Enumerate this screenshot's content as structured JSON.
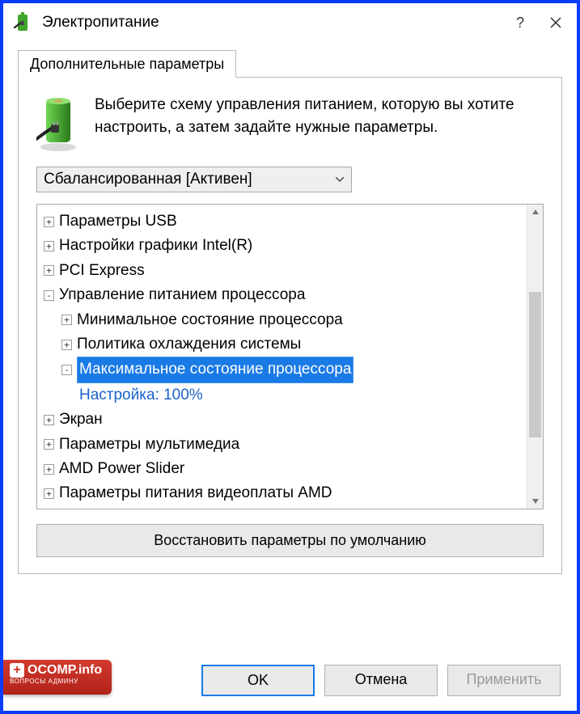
{
  "window": {
    "title": "Электропитание",
    "help_symbol": "?",
    "close_label": "Close"
  },
  "tab": {
    "label": "Дополнительные параметры"
  },
  "intro": {
    "text": "Выберите схему управления питанием, которую вы хотите настроить, а затем задайте нужные параметры."
  },
  "plan_selector": {
    "selected": "Сбалансированная [Активен]"
  },
  "tree": {
    "items": [
      {
        "level": 1,
        "expander": "+",
        "label": "Параметры USB"
      },
      {
        "level": 1,
        "expander": "+",
        "label": "Настройки графики Intel(R)"
      },
      {
        "level": 1,
        "expander": "+",
        "label": "PCI Express"
      },
      {
        "level": 1,
        "expander": "-",
        "label": "Управление питанием процессора"
      },
      {
        "level": 2,
        "expander": "+",
        "label": "Минимальное состояние процессора"
      },
      {
        "level": 2,
        "expander": "+",
        "label": "Политика охлаждения системы"
      },
      {
        "level": 2,
        "expander": "-",
        "label": "Максимальное состояние процессора",
        "selected": true
      },
      {
        "level": 3,
        "setting": true,
        "label": "Настройка: 100%"
      },
      {
        "level": 1,
        "expander": "+",
        "label": "Экран"
      },
      {
        "level": 1,
        "expander": "+",
        "label": "Параметры мультимедиа"
      },
      {
        "level": 1,
        "expander": "+",
        "label": "AMD Power Slider"
      },
      {
        "level": 1,
        "expander": "+",
        "label": "Параметры питания видеоплаты AMD"
      }
    ]
  },
  "buttons": {
    "restore_defaults": "Восстановить параметры по умолчанию",
    "ok": "OK",
    "cancel": "Отмена",
    "apply": "Применить"
  },
  "watermark": {
    "main": "OCOMP.info",
    "sub": "ВОПРОСЫ АДМИНУ"
  },
  "annotation": {
    "arrow_color": "#e6e600",
    "arrow_stroke": "#000000"
  }
}
